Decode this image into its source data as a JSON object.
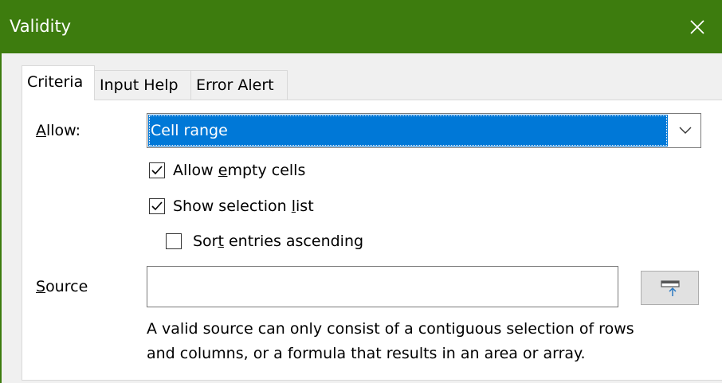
{
  "window": {
    "title": "Validity",
    "close_label": "✕",
    "titlebar_color": "#3d7c0e"
  },
  "tabs": [
    {
      "label": "Criteria",
      "active": true
    },
    {
      "label": "Input Help",
      "active": false
    },
    {
      "label": "Error Alert",
      "active": false
    }
  ],
  "criteria": {
    "allow": {
      "label_mnemonic": "A",
      "label_rest": "llow:",
      "selected": "Cell range",
      "highlight_color": "#0078d7"
    },
    "allow_empty": {
      "checked": true,
      "label_pre": "Allow ",
      "label_mnemonic": "e",
      "label_post": "mpty cells"
    },
    "show_list": {
      "checked": true,
      "label_pre": "Show selection ",
      "label_mnemonic": "l",
      "label_post": "ist"
    },
    "sort_ascending": {
      "checked": false,
      "label_pre": "Sor",
      "label_mnemonic": "t",
      "label_post": " entries ascending"
    },
    "source": {
      "label_mnemonic": "S",
      "label_rest": "ource",
      "value": "",
      "placeholder": ""
    },
    "shrink_icon": "shrink-icon",
    "help_line1": "A valid source can only consist of a contiguous selection of rows",
    "help_line2": "and columns, or a formula that results in an area or array."
  }
}
